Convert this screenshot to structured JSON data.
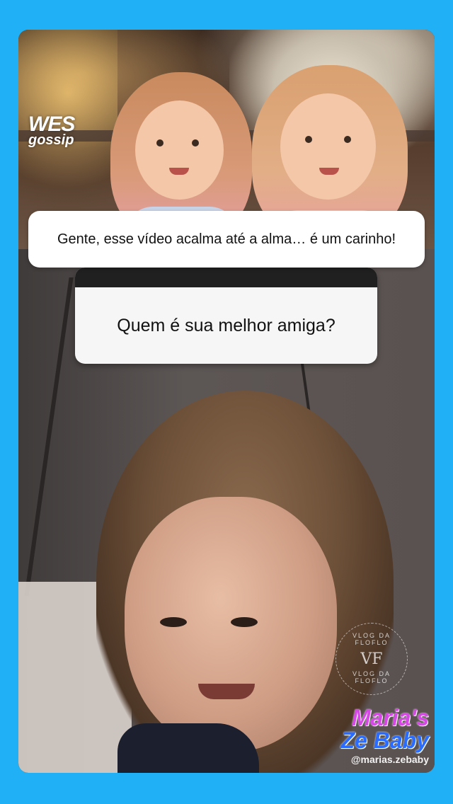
{
  "overlay": {
    "caption": "Gente, esse vídeo acalma até a alma… é um carinho!",
    "logo_line1": "WES",
    "logo_line2": "gossip"
  },
  "question_sticker": {
    "question": "Quem é sua melhor amiga?"
  },
  "watermark": {
    "arc_top": "VLOG DA FLOFLO",
    "monogram": "VF",
    "arc_bottom": "VLOG DA FLOFLO"
  },
  "brand": {
    "name_line1": "Maria's",
    "name_line2": "Ze Baby",
    "handle": "@marias.zebaby"
  },
  "colors": {
    "background": "#1fb0f5",
    "brand_pink": "#d548e6",
    "brand_blue": "#2a6cff"
  }
}
